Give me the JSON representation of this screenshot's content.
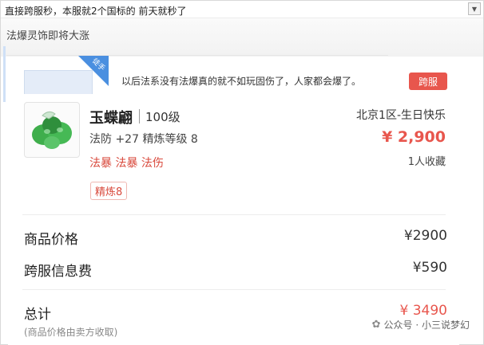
{
  "caption": "直接跨服秒，本服就2个国标的 前天就秒了",
  "header": {
    "title": "法爆灵饰即将大涨"
  },
  "listing": {
    "corner_tag": "徒手",
    "description": "以后法系没有法爆真的就不如玩固伤了，人家都会爆了。",
    "cross_server_tag": "跨服"
  },
  "item": {
    "name": "玉蝶翩",
    "level": "100级",
    "stats": "法防 +27  精炼等级 8",
    "tags": "法暴  法暴  法伤",
    "refine_badge": "精炼8",
    "server": "北京1区-生日快乐",
    "price": "¥ 2,900",
    "favorites": "1人收藏"
  },
  "summary": {
    "price_label": "商品价格",
    "price_value": "¥2900",
    "fee_label": "跨服信息费",
    "fee_value": "¥590",
    "total_label": "总计",
    "total_value": "¥ 3490",
    "total_note": "(商品价格由卖方收取)"
  },
  "watermark": "公众号 · 小三说梦幻",
  "colors": {
    "accent_red": "#e8564d",
    "tag_red": "#d94a3d",
    "corner_blue": "#4a8fe0"
  }
}
